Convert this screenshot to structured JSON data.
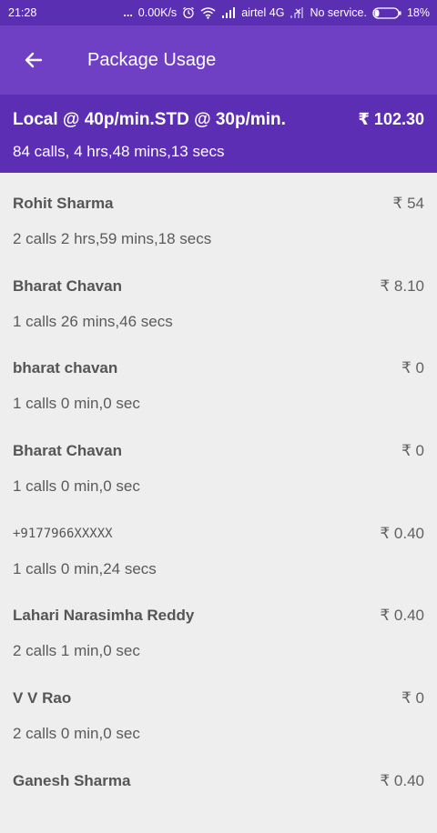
{
  "status": {
    "time": "21:28",
    "dots": "...",
    "speed": "0.00K/s",
    "carrier": "airtel 4G",
    "service": "No service.",
    "battery": "18%"
  },
  "appbar": {
    "title": "Package Usage"
  },
  "summary": {
    "name": "Local @ 40p/min.STD @ 30p/min.",
    "amount": "₹ 102.30",
    "detail": "84 calls, 4 hrs,48 mins,13 secs"
  },
  "calls": [
    {
      "name": "Rohit Sharma",
      "cost": "₹ 54",
      "detail": "2 calls  2 hrs,59 mins,18 secs",
      "mono": false
    },
    {
      "name": "Bharat Chavan",
      "cost": "₹ 8.10",
      "detail": "1 calls  26 mins,46 secs",
      "mono": false
    },
    {
      "name": "bharat chavan",
      "cost": "₹ 0",
      "detail": "1 calls  0 min,0 sec",
      "mono": false
    },
    {
      "name": "Bharat Chavan",
      "cost": "₹ 0",
      "detail": "1 calls  0 min,0 sec",
      "mono": false
    },
    {
      "name": "+9177966XXXXX",
      "cost": "₹ 0.40",
      "detail": "1 calls  0 min,24 secs",
      "mono": true
    },
    {
      "name": "Lahari Narasimha Reddy",
      "cost": "₹ 0.40",
      "detail": "2 calls  1 min,0 sec",
      "mono": false
    },
    {
      "name": "V V Rao",
      "cost": "₹ 0",
      "detail": "2 calls  0 min,0 sec",
      "mono": false
    },
    {
      "name": "Ganesh Sharma",
      "cost": "₹ 0.40",
      "detail": "",
      "mono": false
    }
  ]
}
